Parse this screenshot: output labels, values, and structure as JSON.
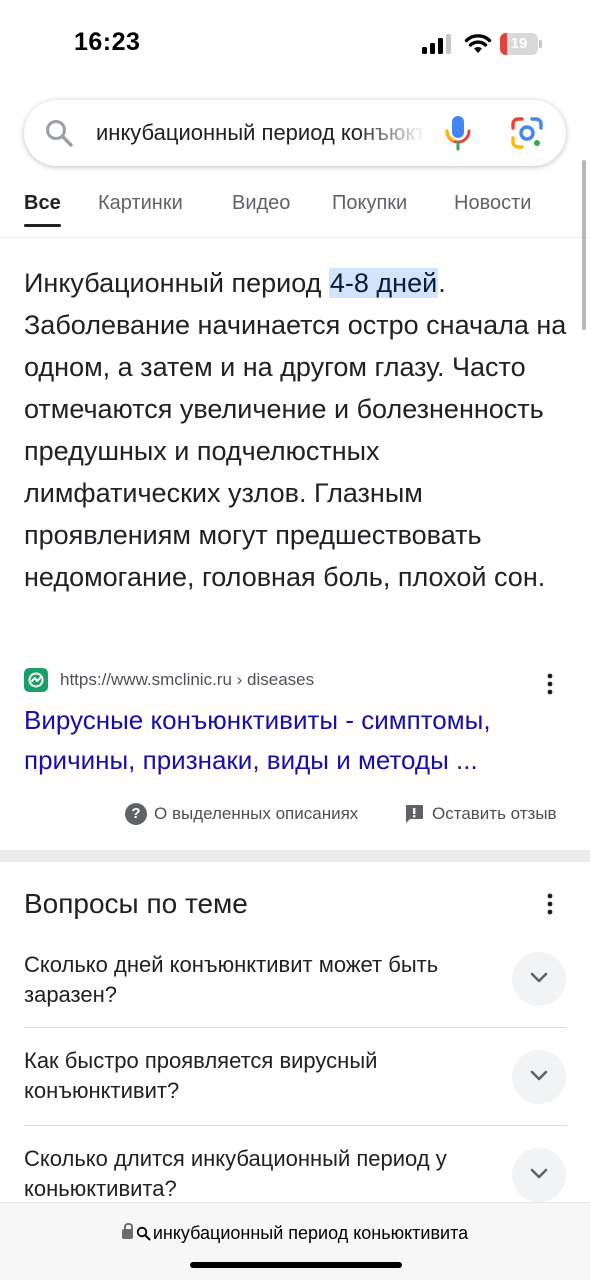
{
  "status_bar": {
    "time": "16:23",
    "battery": "19",
    "battery_level": 0.19
  },
  "search": {
    "query": "инкубационный период конъюктивита",
    "placeholder": ""
  },
  "tabs": [
    {
      "label": "Все",
      "active": true
    },
    {
      "label": "Картинки"
    },
    {
      "label": "Видео"
    },
    {
      "label": "Покупки"
    },
    {
      "label": "Новости"
    }
  ],
  "snippet": {
    "before": "Инкубационный период ",
    "highlight": "4-8 дней",
    "after": ". Заболевание начинается остро сначала на одном, а затем и на другом глазу. Часто отмечаются увеличение и болезненность предушных и подчелюстных лимфатических узлов. Глазным проявлениям могут предшествовать недомогание, головная боль, плохой сон."
  },
  "source": {
    "url": "https://www.smclinic.ru › diseases",
    "title": "Вирусные конъюнктивиты - симптомы, причины, признаки, виды и методы ..."
  },
  "feedback": {
    "about_label": "О выделенных описаниях",
    "feedback_label": "Оставить отзыв"
  },
  "questions": {
    "heading": "Вопросы по теме",
    "items": [
      "Сколько дней конъюнктивит может быть заразен?",
      "Как быстро проявляется вирусный конъюнктивит?",
      "Сколько длится инкубационный период у коньюктивита?"
    ]
  },
  "bottom_bar": {
    "url": "инкубационный период коньюктивита"
  },
  "colors": {
    "link": "#1a0dab",
    "highlight_bg": "#d2e3fc",
    "favicon": "#1a9e6a",
    "battery_low": "#e0433b"
  }
}
